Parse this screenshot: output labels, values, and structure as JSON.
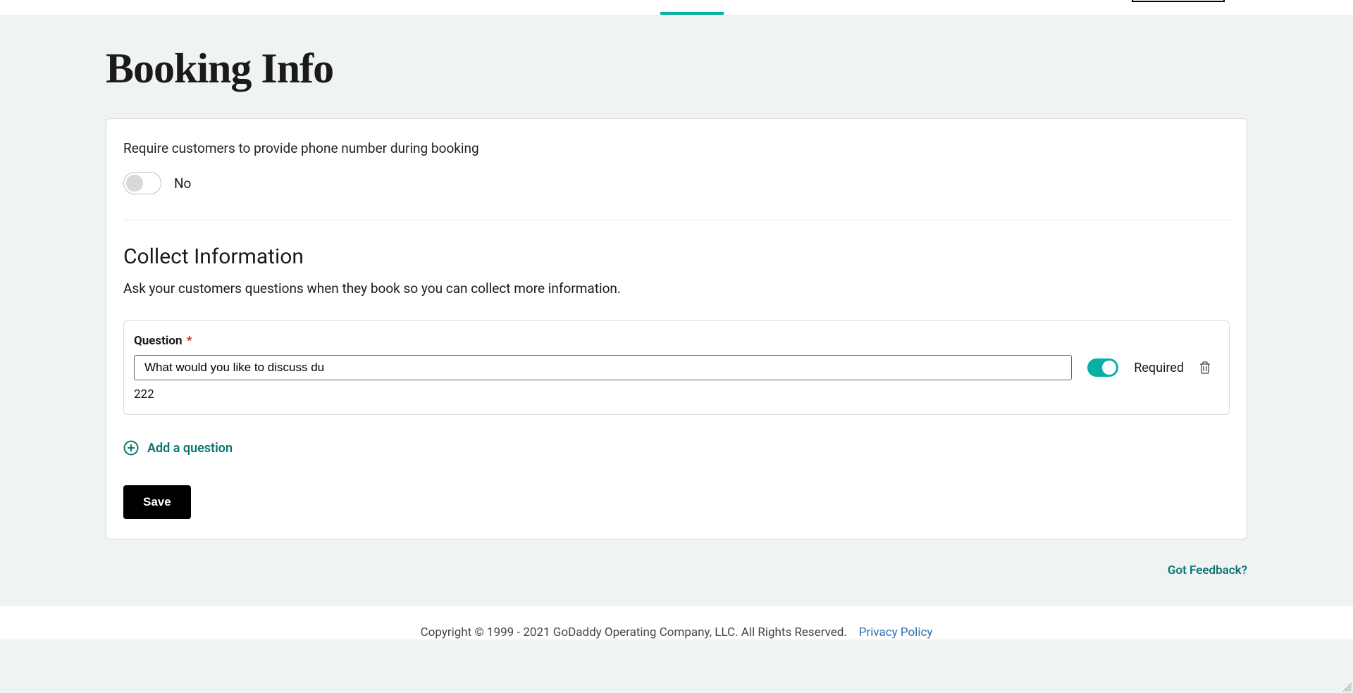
{
  "page": {
    "title": "Booking Info"
  },
  "phone_section": {
    "label": "Require customers to provide phone number during booking",
    "toggle_state": "No"
  },
  "collect_section": {
    "title": "Collect Information",
    "description": "Ask your customers questions when they book so you can collect more information."
  },
  "question": {
    "label": "Question",
    "asterisk": "*",
    "value": "What would you like to discuss du",
    "required_label": "Required",
    "char_count": "222"
  },
  "actions": {
    "add_question": "Add a question",
    "save": "Save"
  },
  "feedback": {
    "link": "Got Feedback?"
  },
  "footer": {
    "copyright": "Copyright © 1999 - 2021 GoDaddy Operating Company, LLC. All Rights Reserved.",
    "privacy": "Privacy Policy"
  }
}
